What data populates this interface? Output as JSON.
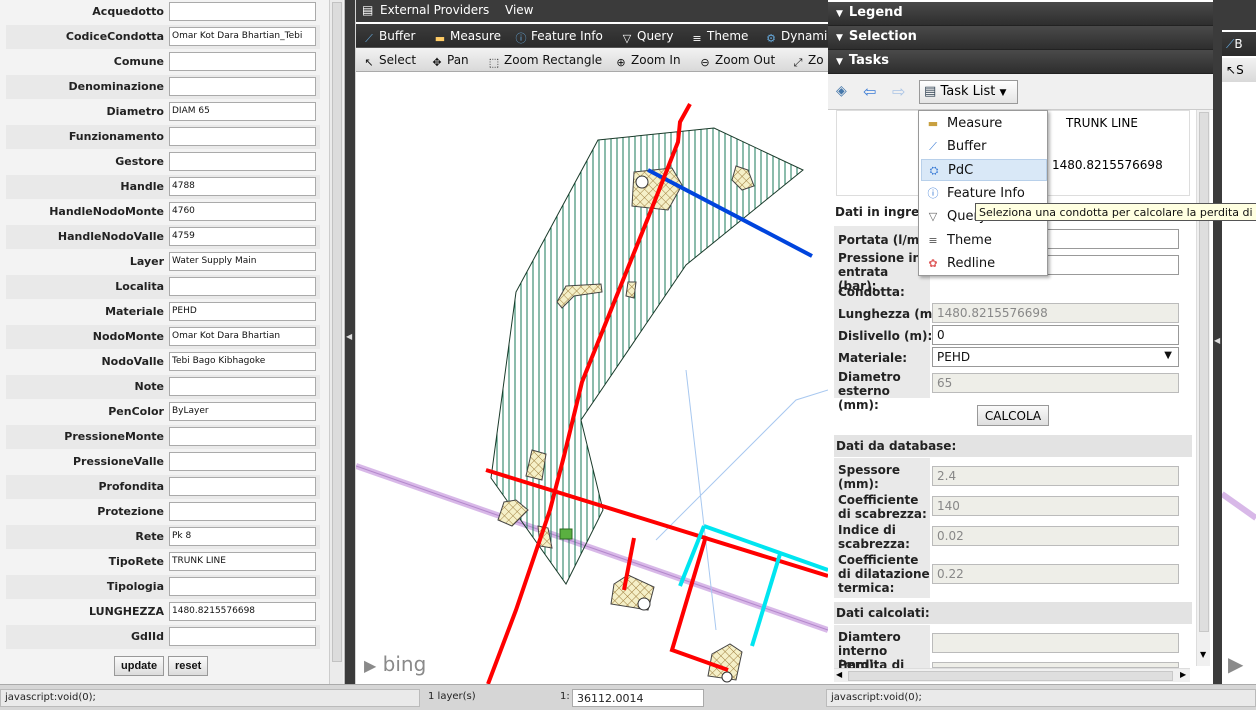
{
  "attributes": [
    {
      "label": "Acquedotto",
      "value": ""
    },
    {
      "label": "CodiceCondotta",
      "value": "Omar Kot Dara Bhartian_Tebi"
    },
    {
      "label": "Comune",
      "value": ""
    },
    {
      "label": "Denominazione",
      "value": ""
    },
    {
      "label": "Diametro",
      "value": "DIAM 65"
    },
    {
      "label": "Funzionamento",
      "value": ""
    },
    {
      "label": "Gestore",
      "value": ""
    },
    {
      "label": "Handle",
      "value": "4788"
    },
    {
      "label": "HandleNodoMonte",
      "value": "4760"
    },
    {
      "label": "HandleNodoValle",
      "value": "4759"
    },
    {
      "label": "Layer",
      "value": "Water Supply Main"
    },
    {
      "label": "Localita",
      "value": ""
    },
    {
      "label": "Materiale",
      "value": "PEHD"
    },
    {
      "label": "NodoMonte",
      "value": "Omar Kot Dara Bhartian"
    },
    {
      "label": "NodoValle",
      "value": "Tebi Bago Kibhagoke"
    },
    {
      "label": "Note",
      "value": ""
    },
    {
      "label": "PenColor",
      "value": "ByLayer"
    },
    {
      "label": "PressioneMonte",
      "value": ""
    },
    {
      "label": "PressioneValle",
      "value": ""
    },
    {
      "label": "Profondita",
      "value": ""
    },
    {
      "label": "Protezione",
      "value": ""
    },
    {
      "label": "Rete",
      "value": "Pk 8"
    },
    {
      "label": "TipoRete",
      "value": "TRUNK LINE"
    },
    {
      "label": "Tipologia",
      "value": ""
    },
    {
      "label": "LUNGHEZZA",
      "value": "1480.8215576698"
    },
    {
      "label": "GdIId",
      "value": ""
    }
  ],
  "left_buttons": {
    "update": "update",
    "reset": "reset"
  },
  "map": {
    "menu": {
      "external_providers": "External Providers",
      "view": "View"
    },
    "toolbar1": {
      "buffer": "Buffer",
      "measure": "Measure",
      "feature_info": "Feature Info",
      "query": "Query",
      "theme": "Theme",
      "dynamic": "Dynami"
    },
    "toolbar2": {
      "select": "Select",
      "pan": "Pan",
      "zoom_rect": "Zoom Rectangle",
      "zoom_in": "Zoom In",
      "zoom_out": "Zoom Out",
      "zoom_ext": "Zo"
    },
    "attribution": "bing"
  },
  "panel": {
    "legend": "Legend",
    "selection": "Selection",
    "tasks": "Tasks",
    "task_list": "Task List",
    "summary": {
      "tiporete": "TRUNK LINE",
      "lunghezza": "1480.8215576698"
    },
    "menu": [
      {
        "label": "Measure",
        "icon": "measure-icon"
      },
      {
        "label": "Buffer",
        "icon": "buffer-icon"
      },
      {
        "label": "PdC",
        "icon": "pdc-icon"
      },
      {
        "label": "Feature Info",
        "icon": "feature-info-icon"
      },
      {
        "label": "Query",
        "icon": "query-icon"
      },
      {
        "label": "Theme",
        "icon": "theme-icon"
      },
      {
        "label": "Redline",
        "icon": "redline-icon"
      }
    ],
    "tooltip": "Seleziona una condotta per calcolare la perdita di carico",
    "section_input": "Dati in ingresso",
    "portata_label": "Portata (l/min):",
    "portata_value": "",
    "pressione_label": "Pressione in entrata (bar):",
    "pressione_value": "",
    "condotta_label": "Condotta:",
    "lunghezza_label": "Lunghezza (m):",
    "lunghezza_value": "1480.8215576698",
    "dislivello_label": "Dislivello (m):",
    "dislivello_value": "0",
    "materiale_label": "Materiale:",
    "materiale_value": "PEHD",
    "diametro_label": "Diametro esterno (mm):",
    "diametro_value": "65",
    "calcola": "CALCOLA",
    "section_db": "Dati da database:",
    "spessore_label": "Spessore (mm):",
    "spessore_value": "2.4",
    "scabrezza_label": "Coefficiente di scabrezza:",
    "scabrezza_value": "140",
    "indice_label": "Indice di scabrezza:",
    "indice_value": "0.02",
    "dilatazione_label": "Coefficiente di dilatazione termica:",
    "dilatazione_value": "0.22",
    "section_calc": "Dati calcolati:",
    "diam_int_label": "Diamtero interno (mm):",
    "diam_int_value": "",
    "perdita_label": "Perdita di",
    "perdita_value": ""
  },
  "status": {
    "left_js": "javascript:void(0);",
    "layers": "1 layer(s)",
    "scale_prefix": "1:",
    "scale": "36112.0014",
    "right_js": "javascript:void(0);"
  },
  "colors": {
    "accent_dark": "#3b3b3b",
    "pipe_red": "#ff0000",
    "pipe_blue": "#0044dd",
    "pipe_cyan": "#00e5f0",
    "zone_green": "#1a7a5a"
  }
}
